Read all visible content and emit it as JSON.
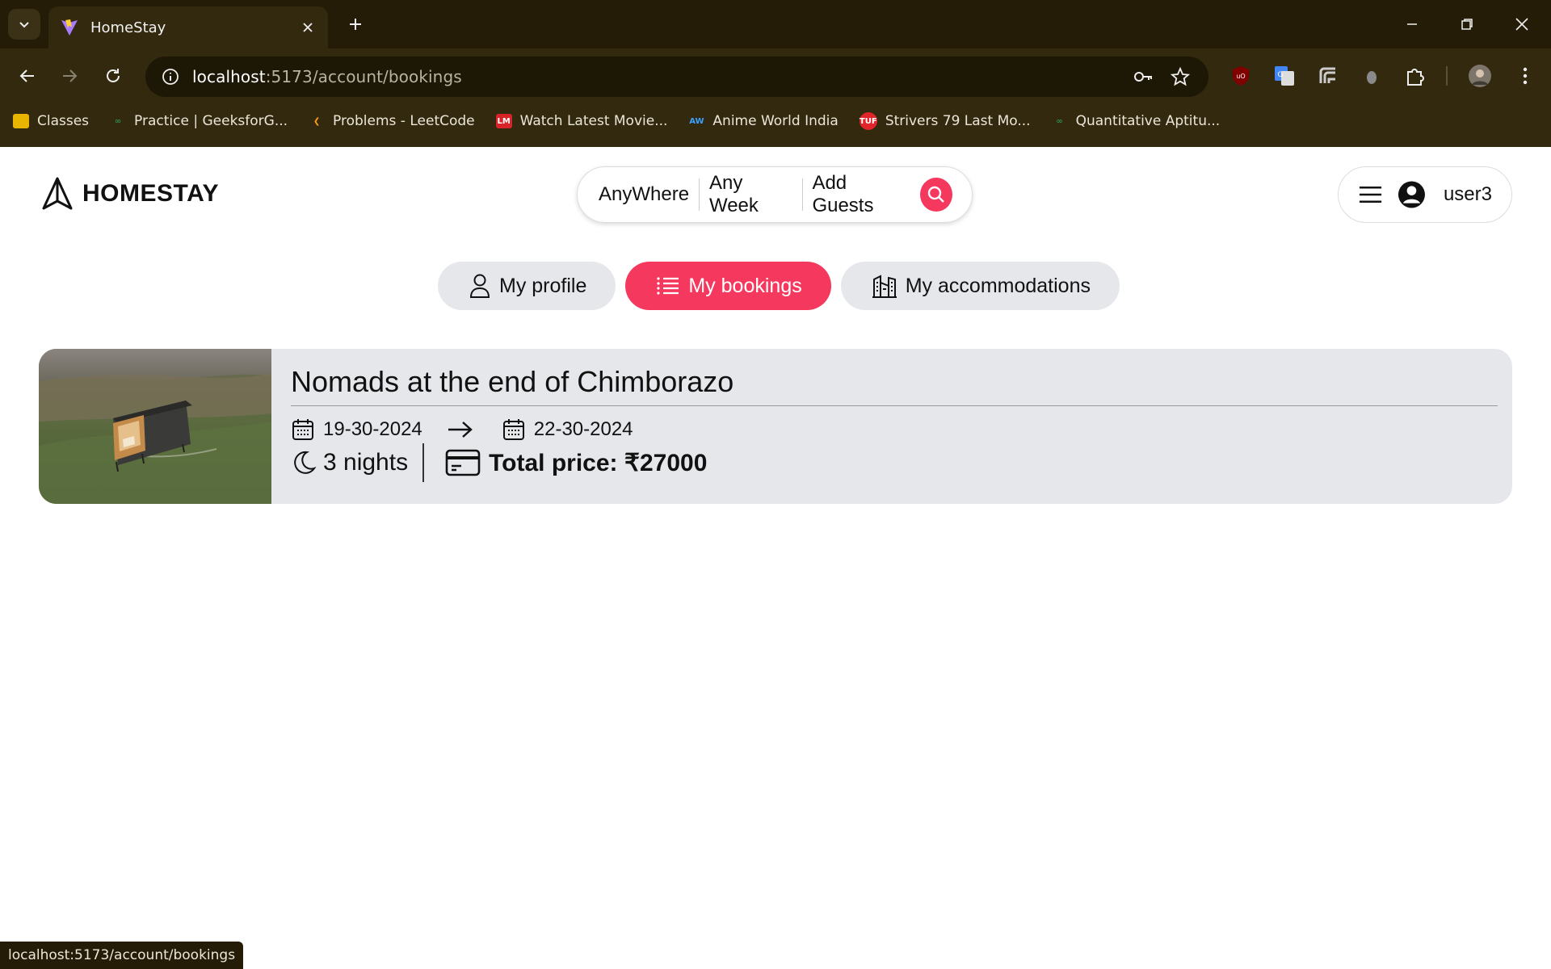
{
  "browser": {
    "tab_title": "HomeStay",
    "url_host": "localhost",
    "url_path": ":5173/account/bookings",
    "status_url": "localhost:5173/account/bookings",
    "bookmarks": [
      {
        "label": "Classes",
        "color": "#e8b600"
      },
      {
        "label": "Practice | GeeksforG...",
        "color": "#2f8d46"
      },
      {
        "label": "Problems - LeetCode",
        "color": "#ffa116"
      },
      {
        "label": "Watch Latest Movie...",
        "color": "#d8232a"
      },
      {
        "label": "Anime World India",
        "color": "#3aa0ff"
      },
      {
        "label": "Strivers 79 Last Mo...",
        "color": "#e0242a"
      },
      {
        "label": "Quantitative Aptitu...",
        "color": "#2f8d46"
      }
    ]
  },
  "header": {
    "brand": "HOMESTAY",
    "search": {
      "where": "AnyWhere",
      "week": "Any Week",
      "guests": "Add Guests"
    },
    "username": "user3"
  },
  "account_tabs": [
    {
      "label": "My profile",
      "active": false
    },
    {
      "label": "My bookings",
      "active": true
    },
    {
      "label": "My accommodations",
      "active": false
    }
  ],
  "bookings": [
    {
      "title": "Nomads at the end of Chimborazo",
      "check_in": "19-30-2024",
      "check_out": "22-30-2024",
      "nights": "3 nights",
      "total_price": "Total price: ₹27000"
    }
  ],
  "colors": {
    "accent": "#f5385d",
    "card": "#e5e7eb"
  }
}
